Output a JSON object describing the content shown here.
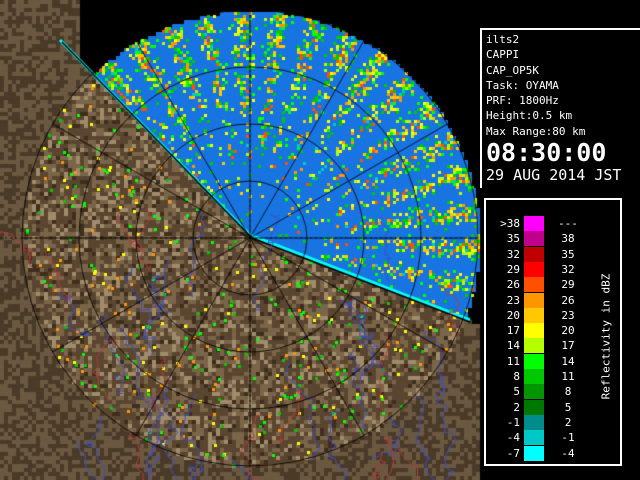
{
  "info": {
    "lines": [
      "ilts2",
      "CAPPI",
      "CAP_OP5K",
      "Task: OYAMA",
      "PRF: 1800Hz",
      "Height:0.5 km",
      "Max Range:80 km"
    ],
    "time": "08:30:00",
    "date": "29 AUG 2014 JST"
  },
  "legend": {
    "title": "Reflectivity in dBZ",
    "rows": [
      {
        "lo": ">38",
        "hi": "---",
        "color": "#ff00ff"
      },
      {
        "lo": "35",
        "hi": "38",
        "color": "#c0008c"
      },
      {
        "lo": "32",
        "hi": "35",
        "color": "#c00000"
      },
      {
        "lo": "29",
        "hi": "32",
        "color": "#ff0000"
      },
      {
        "lo": "26",
        "hi": "29",
        "color": "#ff5000"
      },
      {
        "lo": "23",
        "hi": "26",
        "color": "#ff9600"
      },
      {
        "lo": "20",
        "hi": "23",
        "color": "#ffc800"
      },
      {
        "lo": "17",
        "hi": "20",
        "color": "#ffff00"
      },
      {
        "lo": "14",
        "hi": "17",
        "color": "#b4ff00"
      },
      {
        "lo": "11",
        "hi": "14",
        "color": "#00ff00"
      },
      {
        "lo": "8",
        "hi": "11",
        "color": "#00c800"
      },
      {
        "lo": "5",
        "hi": "8",
        "color": "#009600"
      },
      {
        "lo": "2",
        "hi": "5",
        "color": "#007800"
      },
      {
        "lo": "-1",
        "hi": "2",
        "color": "#008c8c"
      },
      {
        "lo": "-4",
        "hi": "-1",
        "color": "#00c8c8"
      },
      {
        "lo": "-7",
        "hi": "-4",
        "color": "#00ffff"
      }
    ]
  },
  "colors": {
    "sea": "#1874e0",
    "terrain_light": "#a08c6a",
    "terrain_dark": "#5a4630",
    "river": "#3c50c8",
    "border": "#b43c3c",
    "grid": "#000000"
  }
}
